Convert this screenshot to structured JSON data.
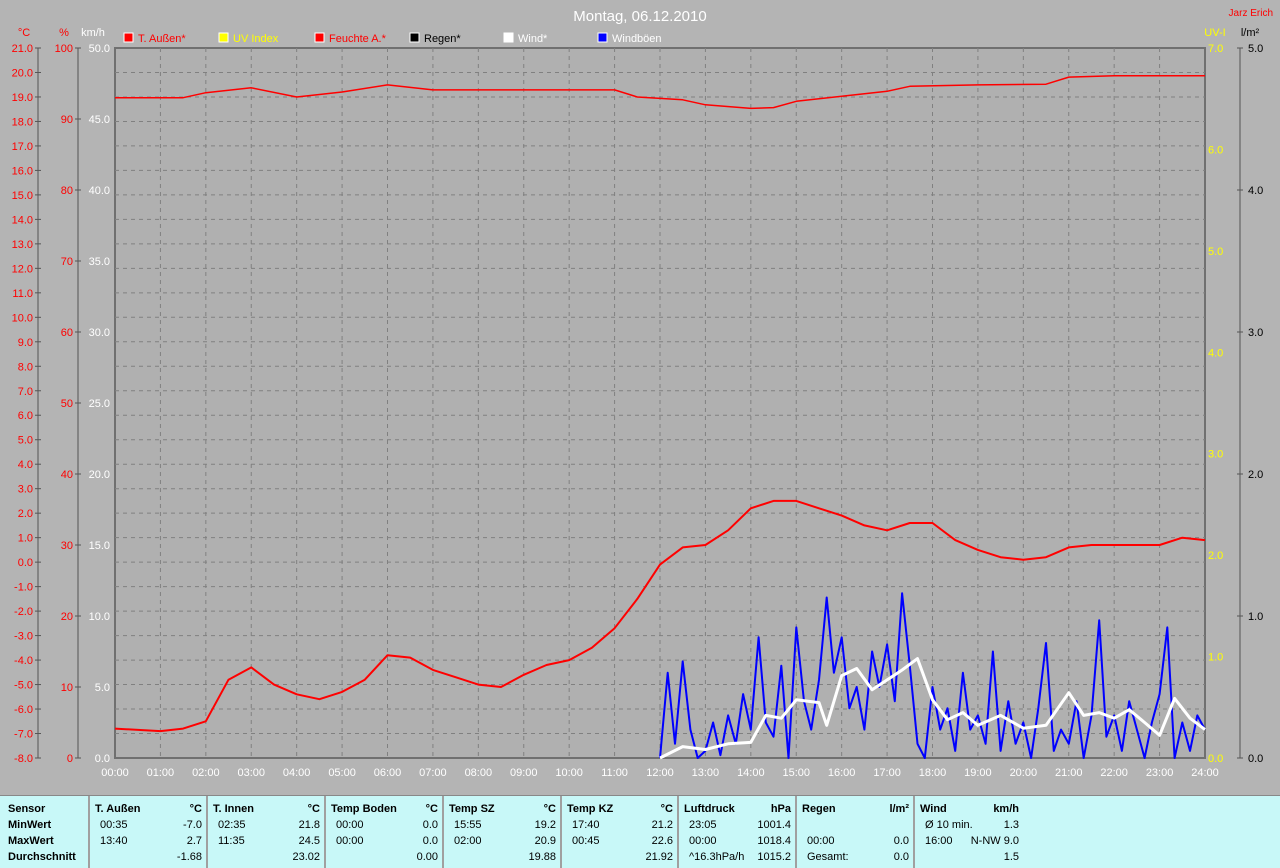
{
  "header": {
    "title": "Montag, 06.12.2010",
    "author": "Jarz Erich"
  },
  "chart_data": {
    "type": "line",
    "title": "Montag, 06.12.2010",
    "legend": [
      "T. Außen*",
      "UV Index",
      "Feuchte A.*",
      "Regen*",
      "Wind*",
      "Windböen"
    ],
    "legend_colors": [
      "#ff0000",
      "#ffff00",
      "#ff0000",
      "#000000",
      "#ffffff",
      "#0000ff"
    ],
    "legend_placement": "top",
    "axes": {
      "temp": {
        "unit": "°C",
        "range": [
          -8,
          21
        ],
        "color": "#ff0000"
      },
      "hum": {
        "unit": "%",
        "range": [
          0,
          100
        ],
        "ticks": [
          0,
          10,
          20,
          30,
          40,
          50,
          60,
          70,
          80,
          90,
          100
        ],
        "color": "#ff0000"
      },
      "wind": {
        "unit": "km/h",
        "range": [
          0,
          50
        ],
        "color": "#ffffff"
      },
      "uv": {
        "unit": "UV-I",
        "range": [
          0,
          7
        ],
        "color": "#ffff00"
      },
      "rain": {
        "unit": "l/m²",
        "range": [
          0,
          5
        ],
        "color": "#000000"
      }
    },
    "x_ticks": [
      "00:00",
      "01:00",
      "02:00",
      "03:00",
      "04:00",
      "05:00",
      "06:00",
      "07:00",
      "08:00",
      "09:00",
      "10:00",
      "11:00",
      "12:00",
      "13:00",
      "14:00",
      "15:00",
      "16:00",
      "17:00",
      "18:00",
      "19:00",
      "20:00",
      "21:00",
      "22:00",
      "23:00",
      "24:00"
    ],
    "grid": true,
    "series": [
      {
        "name": "T. Außen*",
        "axis": "temp",
        "color": "#ff0000",
        "x": [
          0,
          1,
          1.5,
          2,
          2.5,
          3,
          3.5,
          4,
          4.5,
          5,
          5.5,
          6,
          6.5,
          7,
          7.5,
          8,
          8.5,
          9,
          9.5,
          10,
          10.5,
          11,
          11.5,
          12,
          12.5,
          13,
          13.5,
          14,
          14.5,
          15,
          15.5,
          16,
          16.5,
          17,
          17.5,
          18,
          18.5,
          19,
          19.5,
          20,
          20.5,
          21,
          21.5,
          22,
          22.5,
          23,
          23.5,
          24
        ],
        "y": [
          -6.8,
          -6.9,
          -6.8,
          -6.5,
          -4.8,
          -4.3,
          -5.0,
          -5.4,
          -5.6,
          -5.3,
          -4.8,
          -3.8,
          -3.9,
          -4.4,
          -4.7,
          -5.0,
          -5.1,
          -4.6,
          -4.2,
          -4.0,
          -3.5,
          -2.7,
          -1.5,
          -0.1,
          0.6,
          0.7,
          1.3,
          2.2,
          2.5,
          2.5,
          2.2,
          1.9,
          1.5,
          1.3,
          1.6,
          1.6,
          0.9,
          0.5,
          0.2,
          0.1,
          0.2,
          0.6,
          0.7,
          0.7,
          0.7,
          0.7,
          1.0,
          0.9
        ]
      },
      {
        "name": "Feuchte A.*",
        "axis": "hum",
        "color": "#ff0000",
        "x": [
          0,
          1.5,
          2,
          3,
          4,
          5,
          6,
          7,
          9,
          11,
          11.5,
          12.5,
          13,
          14,
          14.5,
          15,
          16,
          17,
          17.5,
          19,
          20.5,
          21,
          22,
          24
        ],
        "y": [
          93.0,
          93.0,
          93.7,
          94.4,
          93.1,
          93.8,
          94.8,
          94.1,
          94.1,
          94.1,
          93.1,
          92.7,
          92.0,
          91.5,
          91.6,
          92.5,
          93.2,
          93.9,
          94.6,
          94.8,
          94.9,
          95.9,
          96.1,
          96.1
        ]
      },
      {
        "name": "Windböen",
        "axis": "wind",
        "color": "#0000ff",
        "x": [
          12,
          12.17,
          12.33,
          12.5,
          12.67,
          12.83,
          13,
          13.17,
          13.33,
          13.5,
          13.67,
          13.83,
          14,
          14.17,
          14.33,
          14.5,
          14.67,
          14.83,
          15,
          15.17,
          15.33,
          15.5,
          15.67,
          15.83,
          16,
          16.17,
          16.33,
          16.5,
          16.67,
          16.83,
          17,
          17.17,
          17.33,
          17.5,
          17.67,
          17.83,
          18,
          18.17,
          18.33,
          18.5,
          18.67,
          18.83,
          19,
          19.17,
          19.33,
          19.5,
          19.67,
          19.83,
          20,
          20.17,
          20.33,
          20.5,
          20.67,
          20.83,
          21,
          21.17,
          21.33,
          21.5,
          21.67,
          21.83,
          22,
          22.17,
          22.33,
          22.5,
          22.67,
          22.83,
          23,
          23.17,
          23.33,
          23.5,
          23.67,
          23.83,
          24
        ],
        "y": [
          0,
          6.0,
          1.0,
          6.8,
          2.0,
          0,
          0.5,
          2.5,
          0.2,
          3.0,
          1.0,
          4.5,
          2.0,
          8.5,
          2.5,
          1.5,
          6.5,
          0,
          9.2,
          4.0,
          2.0,
          5.5,
          11.3,
          6.0,
          8.5,
          3.5,
          5.0,
          2.0,
          7.5,
          5.0,
          8.0,
          4.0,
          11.6,
          6.5,
          1.0,
          0,
          5.0,
          2.0,
          3.5,
          0.5,
          6.0,
          2.0,
          3.0,
          1.0,
          7.5,
          0.5,
          4.0,
          1.0,
          2.5,
          0,
          3.5,
          8.1,
          0.5,
          2.0,
          1.0,
          4.0,
          0,
          3.0,
          9.7,
          1.5,
          3.0,
          0.5,
          4.0,
          2.0,
          0,
          2.5,
          4.5,
          9.2,
          0,
          2.5,
          0.5,
          3.0,
          2.0
        ]
      },
      {
        "name": "Wind*",
        "axis": "wind",
        "color": "#ffffff",
        "x": [
          12,
          12.5,
          13,
          13.5,
          14,
          14.33,
          14.67,
          15,
          15.5,
          15.67,
          16,
          16.33,
          16.67,
          17,
          17.33,
          17.67,
          18,
          18.33,
          18.67,
          19,
          19.5,
          20,
          20.5,
          21,
          21.33,
          21.67,
          22,
          22.33,
          22.67,
          23,
          23.33,
          23.67,
          24
        ],
        "y": [
          0,
          0.8,
          0.6,
          1.0,
          1.1,
          3.0,
          2.8,
          4.1,
          3.9,
          2.3,
          5.8,
          6.3,
          4.8,
          5.5,
          6.2,
          7.0,
          4.1,
          2.7,
          3.2,
          2.3,
          3.0,
          2.1,
          2.3,
          4.6,
          3.0,
          3.2,
          2.8,
          3.4,
          2.5,
          1.6,
          4.2,
          2.8,
          2.0
        ]
      }
    ]
  },
  "table": {
    "row_labels": [
      "Sensor",
      "MinWert",
      "MaxWert",
      "Durchschnitt"
    ],
    "columns": [
      {
        "name": "T. Außen",
        "unit": "°C",
        "rows": [
          [
            "00:35",
            "-7.0"
          ],
          [
            "13:40",
            "2.7"
          ],
          [
            "",
            "-1.68"
          ]
        ]
      },
      {
        "name": "T. Innen",
        "unit": "°C",
        "rows": [
          [
            "02:35",
            "21.8"
          ],
          [
            "11:35",
            "24.5"
          ],
          [
            "",
            "23.02"
          ]
        ]
      },
      {
        "name": "Temp Boden",
        "unit": "°C",
        "rows": [
          [
            "00:00",
            "0.0"
          ],
          [
            "00:00",
            "0.0"
          ],
          [
            "",
            "0.00"
          ]
        ]
      },
      {
        "name": "Temp SZ",
        "unit": "°C",
        "rows": [
          [
            "15:55",
            "19.2"
          ],
          [
            "02:00",
            "20.9"
          ],
          [
            "",
            "19.88"
          ]
        ]
      },
      {
        "name": "Temp KZ",
        "unit": "°C",
        "rows": [
          [
            "17:40",
            "21.2"
          ],
          [
            "00:45",
            "22.6"
          ],
          [
            "",
            "21.92"
          ]
        ]
      },
      {
        "name": "Luftdruck",
        "unit": "hPa",
        "rows": [
          [
            "23:05",
            "1001.4"
          ],
          [
            "00:00",
            "1018.4"
          ],
          [
            "^16.3hPa/h",
            "1015.2"
          ]
        ]
      },
      {
        "name": "Regen",
        "unit": "l/m²",
        "rows": [
          [
            "",
            ""
          ],
          [
            "00:00",
            "0.0"
          ],
          [
            "Gesamt:",
            "0.0"
          ]
        ]
      },
      {
        "name": "Wind",
        "unit": "km/h",
        "rows": [
          [
            "Ø 10 min.",
            "1.3"
          ],
          [
            "16:00",
            "N-NW 9.0"
          ],
          [
            "",
            "1.5"
          ]
        ]
      }
    ]
  }
}
